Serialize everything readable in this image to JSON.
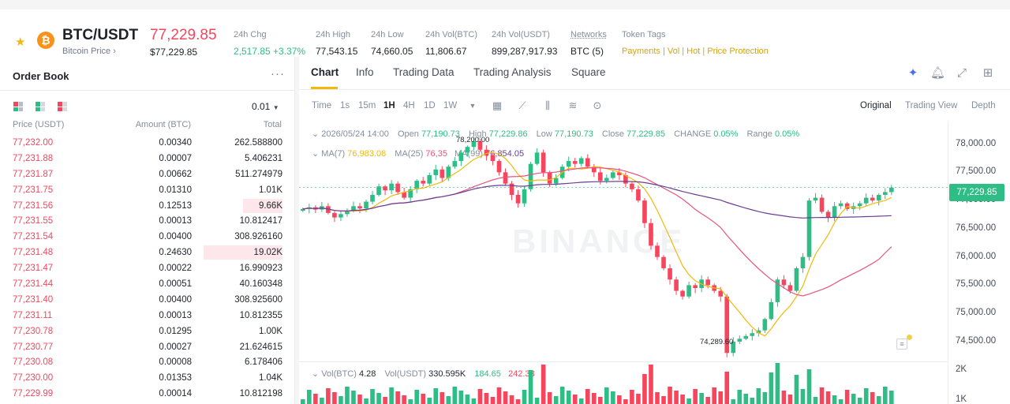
{
  "header": {
    "pair": "BTC/USDT",
    "subtitle": "Bitcoin Price ›",
    "price": "77,229.85",
    "price_usd": "$77,229.85",
    "stats": [
      {
        "label": "24h Chg",
        "value": "2,517.85 +3.37%"
      },
      {
        "label": "24h High",
        "value": "77,543.15"
      },
      {
        "label": "24h Low",
        "value": "74,660.05"
      },
      {
        "label": "24h Vol(BTC)",
        "value": "11,806.67"
      },
      {
        "label": "24h Vol(USDT)",
        "value": "899,287,917.93"
      },
      {
        "label": "Networks",
        "value": "BTC (5)"
      }
    ],
    "token_tags_label": "Token Tags",
    "token_tags": "Payments | Vol | Hot | Price Protection",
    "colors": {
      "up": "#2ebd85",
      "down": "#f6465d",
      "accent": "#f0b90b"
    }
  },
  "orderbook": {
    "title": "Order Book",
    "more": "···",
    "precision": "0.01",
    "headers": {
      "price": "Price (USDT)",
      "amount": "Amount (BTC)",
      "total": "Total"
    },
    "rows": [
      {
        "price": "77,232.00",
        "amount": "0.00340",
        "total": "262.588800",
        "depth": 0
      },
      {
        "price": "77,231.88",
        "amount": "0.00007",
        "total": "5.406231",
        "depth": 0
      },
      {
        "price": "77,231.87",
        "amount": "0.00662",
        "total": "511.274979",
        "depth": 0
      },
      {
        "price": "77,231.75",
        "amount": "0.01310",
        "total": "1.01K",
        "depth": 0
      },
      {
        "price": "77,231.56",
        "amount": "0.12513",
        "total": "9.66K",
        "depth": 0.5
      },
      {
        "price": "77,231.55",
        "amount": "0.00013",
        "total": "10.812417",
        "depth": 0
      },
      {
        "price": "77,231.54",
        "amount": "0.00400",
        "total": "308.926160",
        "depth": 0
      },
      {
        "price": "77,231.48",
        "amount": "0.24630",
        "total": "19.02K",
        "depth": 1.0
      },
      {
        "price": "77,231.47",
        "amount": "0.00022",
        "total": "16.990923",
        "depth": 0
      },
      {
        "price": "77,231.44",
        "amount": "0.00051",
        "total": "40.160348",
        "depth": 0
      },
      {
        "price": "77,231.40",
        "amount": "0.00400",
        "total": "308.925600",
        "depth": 0
      },
      {
        "price": "77,231.11",
        "amount": "0.00013",
        "total": "10.812355",
        "depth": 0
      },
      {
        "price": "77,230.78",
        "amount": "0.01295",
        "total": "1.00K",
        "depth": 0
      },
      {
        "price": "77,230.77",
        "amount": "0.00027",
        "total": "21.624615",
        "depth": 0
      },
      {
        "price": "77,230.08",
        "amount": "0.00008",
        "total": "6.178406",
        "depth": 0
      },
      {
        "price": "77,230.00",
        "amount": "0.01353",
        "total": "1.04K",
        "depth": 0
      },
      {
        "price": "77,229.99",
        "amount": "0.00014",
        "total": "10.812198",
        "depth": 0
      }
    ]
  },
  "chart": {
    "tabs": [
      "Chart",
      "Info",
      "Trading Data",
      "Trading Analysis",
      "Square"
    ],
    "active_tab": "Chart",
    "intervals": [
      "Time",
      "1s",
      "15m",
      "1H",
      "4H",
      "1D",
      "1W"
    ],
    "active_interval": "1H",
    "modes": [
      "Original",
      "Trading View",
      "Depth"
    ],
    "active_mode": "Original",
    "ohlc": {
      "date": "2026/05/24 14:00",
      "open_label": "Open",
      "open": "77,190.73",
      "high_label": "High",
      "high": "77,229.86",
      "low_label": "Low",
      "low": "77,190.73",
      "close_label": "Close",
      "close": "77,229.85",
      "change_label": "CHANGE",
      "change": "0.05%",
      "range_label": "Range",
      "range": "0.05%"
    },
    "ma": {
      "ma7_label": "MA(7)",
      "ma7": "76,983.08",
      "ma25_label": "MA(25)",
      "ma25": "76,35",
      "ma99_label": "MA(99)",
      "ma99": "76,854.05"
    },
    "watermark": "BINANCE",
    "high_marker": "78,200.00",
    "low_marker": "74,289.60",
    "last_price": "77,229.85",
    "y_ticks": [
      "78,000.00",
      "77,500.00",
      "77,000.00",
      "76,500.00",
      "76,000.00",
      "75,500.00",
      "75,000.00",
      "74,500.00"
    ],
    "volume": {
      "label": "Vol(BTC)",
      "btc": "4.28",
      "usdt_label": "Vol(USDT)",
      "usdt": "330.595K",
      "ma5": "184.65",
      "ma10": "242.33",
      "y_ticks": [
        "2K",
        "1K"
      ]
    }
  },
  "chart_data": {
    "type": "candlestick",
    "ylim": [
      74150,
      78400
    ],
    "y_ticks": [
      78000,
      77500,
      77000,
      76500,
      76000,
      75500,
      75000,
      74500
    ],
    "close_series": [
      76850,
      76880,
      76840,
      76900,
      76780,
      76700,
      76760,
      76820,
      76900,
      76860,
      76980,
      77100,
      77250,
      77180,
      77300,
      77150,
      77050,
      77200,
      77350,
      77300,
      77450,
      77550,
      77400,
      77600,
      77700,
      77850,
      77950,
      78050,
      77900,
      77800,
      77700,
      77500,
      77300,
      77100,
      76950,
      77200,
      77650,
      77850,
      77500,
      77300,
      77400,
      77600,
      77700,
      77650,
      77750,
      77600,
      77500,
      77350,
      77400,
      77500,
      77450,
      77300,
      77200,
      77000,
      76600,
      76200,
      76000,
      75800,
      75600,
      75400,
      75300,
      75500,
      75450,
      75600,
      75500,
      75400,
      75300,
      74300,
      74500,
      74550,
      74600,
      74650,
      74700,
      74900,
      75200,
      75600,
      75500,
      75400,
      75800,
      76000,
      77000,
      77050,
      76800,
      76700,
      76900,
      76950,
      76850,
      76900,
      76950,
      77050,
      77000,
      77100,
      77150,
      77229.85
    ],
    "ma7_start": 76800,
    "ma99_visible": true
  }
}
